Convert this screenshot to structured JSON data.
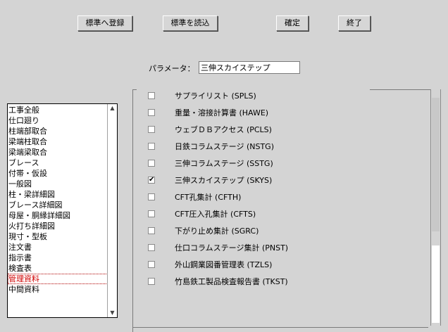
{
  "toolbar": {
    "register_label": "標準へ登録",
    "load_label": "標準を読込",
    "confirm_label": "確定",
    "exit_label": "終了"
  },
  "parameter": {
    "label": "パラメータ：",
    "value": "三伸スカイステップ"
  },
  "category_list": {
    "items": [
      "工事全般",
      "仕口廻り",
      "柱端部取合",
      "梁端柱取合",
      "梁端梁取合",
      "ブレース",
      "付帯・仮設",
      "一般図",
      "柱・梁詳細図",
      "ブレース詳細図",
      "母屋・胴縁詳細図",
      "火打ち詳細図",
      "現寸・型板",
      "注文書",
      "指示書",
      "検査表",
      "管理資料",
      "中間資料"
    ],
    "selected_index": 16
  },
  "options": [
    {
      "label": "サプライリスト (SPLS)",
      "checked": false
    },
    {
      "label": "重量・溶接計算書 (HAWE)",
      "checked": false
    },
    {
      "label": "ウェブＤＢアクセス (PCLS)",
      "checked": false
    },
    {
      "label": "日鉄コラムステージ (NSTG)",
      "checked": false
    },
    {
      "label": "三伸コラムステージ (SSTG)",
      "checked": false
    },
    {
      "label": "三伸スカイステップ (SKYS)",
      "checked": true
    },
    {
      "label": "CFT孔集計 (CFTH)",
      "checked": false
    },
    {
      "label": "CFT圧入孔集計 (CFTS)",
      "checked": false
    },
    {
      "label": "下がり止め集計 (SGRC)",
      "checked": false
    },
    {
      "label": "仕口コラムステージ集計 (PNST)",
      "checked": false
    },
    {
      "label": "外山鋼業図番管理表 (TZLS)",
      "checked": false
    },
    {
      "label": "竹島鉄工製品検査報告書 (TKST)",
      "checked": false
    }
  ]
}
